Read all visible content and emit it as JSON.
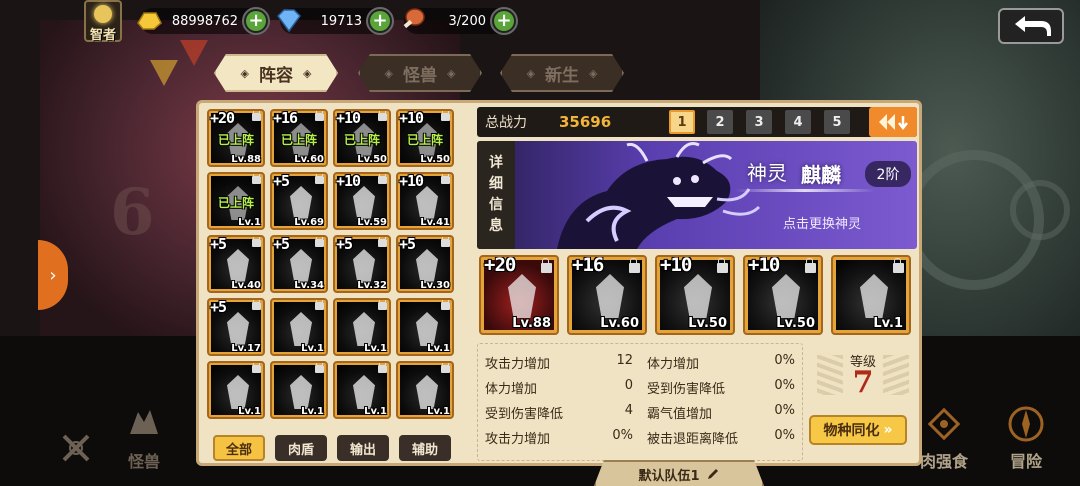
{
  "player": {
    "title": "智者"
  },
  "resources": {
    "gold": {
      "icon": "gold-ingot-icon",
      "value": "88998762"
    },
    "gem": {
      "icon": "diamond-icon",
      "value": "19713"
    },
    "stamina": {
      "icon": "meat-icon",
      "value": "3/200"
    }
  },
  "tabs": [
    {
      "label": "阵容",
      "active": true
    },
    {
      "label": "怪兽",
      "active": false
    },
    {
      "label": "新生",
      "active": false
    }
  ],
  "roster": [
    {
      "plus": "+20",
      "level": "Lv.88",
      "deployed": "已上阵"
    },
    {
      "plus": "+16",
      "level": "Lv.60",
      "deployed": "已上阵"
    },
    {
      "plus": "+10",
      "level": "Lv.50",
      "deployed": "已上阵"
    },
    {
      "plus": "+10",
      "level": "Lv.50",
      "deployed": "已上阵"
    },
    {
      "plus": "",
      "level": "Lv.1",
      "deployed": "已上阵"
    },
    {
      "plus": "+5",
      "level": "Lv.69",
      "deployed": ""
    },
    {
      "plus": "+10",
      "level": "Lv.59",
      "deployed": ""
    },
    {
      "plus": "+10",
      "level": "Lv.41",
      "deployed": ""
    },
    {
      "plus": "+5",
      "level": "Lv.40",
      "deployed": ""
    },
    {
      "plus": "+5",
      "level": "Lv.34",
      "deployed": ""
    },
    {
      "plus": "+5",
      "level": "Lv.32",
      "deployed": ""
    },
    {
      "plus": "+5",
      "level": "Lv.30",
      "deployed": ""
    },
    {
      "plus": "+5",
      "level": "Lv.17",
      "deployed": ""
    },
    {
      "plus": "",
      "level": "Lv.1",
      "deployed": ""
    },
    {
      "plus": "",
      "level": "Lv.1",
      "deployed": ""
    },
    {
      "plus": "",
      "level": "Lv.1",
      "deployed": ""
    },
    {
      "plus": "",
      "level": "Lv.1",
      "deployed": ""
    },
    {
      "plus": "",
      "level": "Lv.1",
      "deployed": ""
    },
    {
      "plus": "",
      "level": "Lv.1",
      "deployed": ""
    },
    {
      "plus": "",
      "level": "Lv.1",
      "deployed": ""
    }
  ],
  "filters": [
    {
      "label": "全部",
      "active": true
    },
    {
      "label": "肉盾",
      "active": false
    },
    {
      "label": "输出",
      "active": false
    },
    {
      "label": "辅助",
      "active": false
    }
  ],
  "power": {
    "label": "总战力",
    "value": "35696"
  },
  "team_slots": [
    {
      "label": "1",
      "active": true
    },
    {
      "label": "2",
      "active": false
    },
    {
      "label": "3",
      "active": false
    },
    {
      "label": "4",
      "active": false
    },
    {
      "label": "5",
      "active": false
    }
  ],
  "god": {
    "detail_tab": [
      "详",
      "细",
      "信",
      "息"
    ],
    "type": "神灵",
    "name": "麒麟",
    "stage": "2阶",
    "hint": "点击更换神灵"
  },
  "team": [
    {
      "plus": "+20",
      "level": "Lv.88",
      "locked": true
    },
    {
      "plus": "+16",
      "level": "Lv.60",
      "locked": true
    },
    {
      "plus": "+10",
      "level": "Lv.50",
      "locked": true
    },
    {
      "plus": "+10",
      "level": "Lv.50",
      "locked": true
    },
    {
      "plus": "",
      "level": "Lv.1",
      "locked": true
    }
  ],
  "stats": [
    {
      "label": "攻击力增加",
      "value": "12"
    },
    {
      "label": "体力增加",
      "value": "0%"
    },
    {
      "label": "体力增加",
      "value": "0"
    },
    {
      "label": "受到伤害降低",
      "value": "0%"
    },
    {
      "label": "受到伤害降低",
      "value": "4"
    },
    {
      "label": "霸气值增加",
      "value": "0%"
    },
    {
      "label": "攻击力增加",
      "value": "0%"
    },
    {
      "label": "被击退距离降低",
      "value": "0%"
    }
  ],
  "level": {
    "label": "等级",
    "value": "7"
  },
  "sync_button": "物种同化",
  "team_name": "默认队伍1",
  "bottom_nav": [
    {
      "label": "",
      "icon": "crossed-swords-icon"
    },
    {
      "label": "怪兽",
      "icon": "beast-icon"
    },
    {
      "label": "肉强食",
      "icon": "feast-icon"
    },
    {
      "label": "冒险",
      "icon": "compass-icon"
    }
  ],
  "colors": {
    "accent_gold": "#f0b53a",
    "panel_bg": "#efe3c4",
    "god_purple": "#5a3fb0",
    "deployed_green": "#b6f04a",
    "level_red": "#b02a1a"
  }
}
